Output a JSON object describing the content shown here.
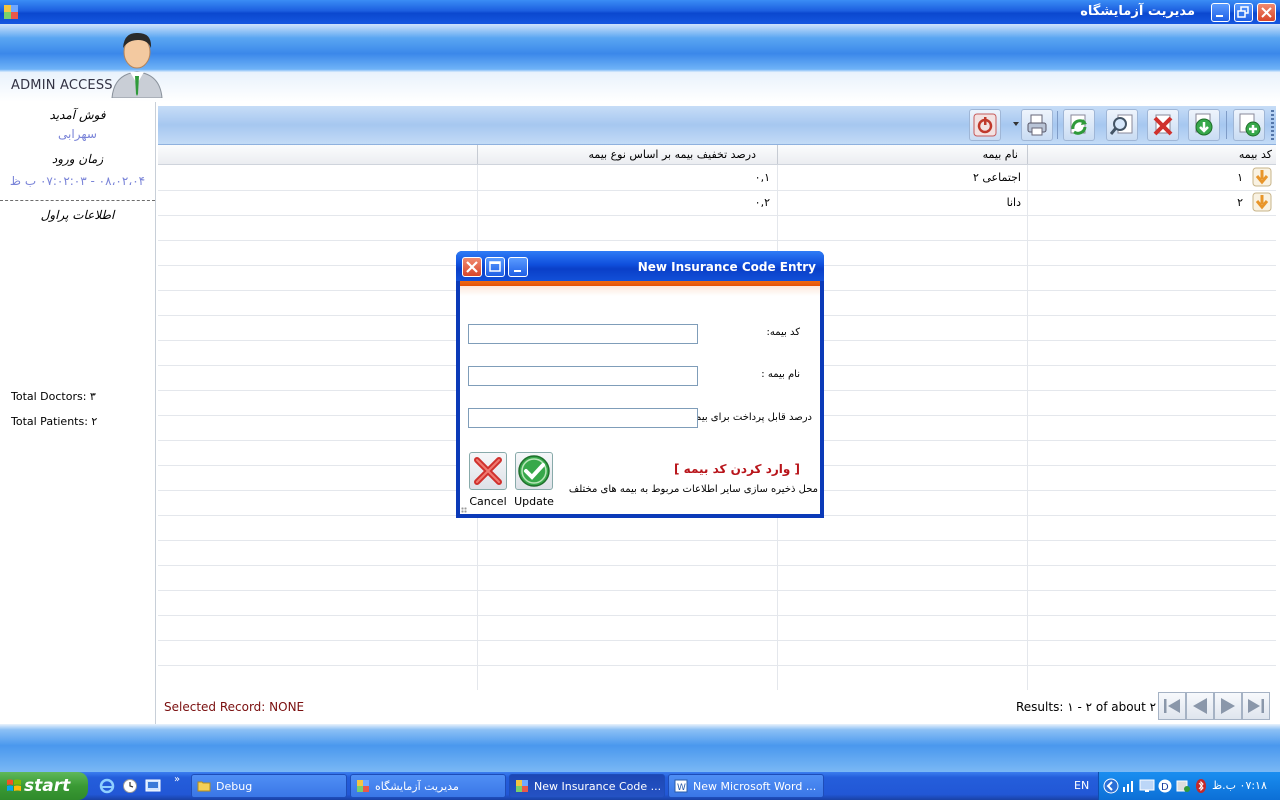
{
  "window": {
    "title": "مدیریت آزمایشگاه"
  },
  "header": {
    "admin_label": "ADMIN ACCESS"
  },
  "sidebar": {
    "user_label": "فوش آمدید",
    "user_name": "سهرابی",
    "login_label": "زمان ورود",
    "login_time": "۰۸،۰۲،۰۴ - ۰۷:۰۲:۰۳ ب ظ",
    "info_label": "اطلاعات پراول",
    "total_doctors": "Total Doctors: ۳",
    "total_patients": "Total Patients: ۲"
  },
  "toolbar": {
    "buttons": [
      "power-icon",
      "print-icon",
      "refresh-icon",
      "search-icon",
      "delete-icon",
      "download-icon",
      "add-icon"
    ]
  },
  "grid": {
    "columns": [
      "کد بیمه",
      "نام بیمه",
      "درصد تخفیف بیمه بر اساس نوع بیمه",
      ""
    ],
    "rows": [
      {
        "code": "۱",
        "name": "اجتماعی ۲",
        "percent": "۰,۱"
      },
      {
        "code": "۲",
        "name": "دانا",
        "percent": "۰,۲"
      }
    ]
  },
  "status": {
    "selected": "Selected Record: NONE",
    "results": "Results: ۱ - ۲ of about ۲"
  },
  "dialog": {
    "title": "New Insurance Code Entry",
    "code_label": "کد بیمه:",
    "name_label": "نام بیمه :",
    "percent_label": "درصد قابل پرداخت برای بیمه",
    "code_value": "",
    "name_value": "",
    "percent_value": "",
    "heading": "[ وارد کردن کد بیمه ]",
    "note": "محل ذخیره سازی سایر اطلاعات مربوط به بیمه های مختلف",
    "cancel_label": "Cancel",
    "update_label": "Update"
  },
  "taskbar": {
    "start_label": "start",
    "tasks": [
      {
        "label": "Debug",
        "active": false
      },
      {
        "label": "مدیریت آزمایشگاه",
        "active": false
      },
      {
        "label": "New Insurance Code ...",
        "active": true
      },
      {
        "label": "New Microsoft Word ...",
        "active": false
      }
    ],
    "lang": "EN",
    "clock": "۰۷:۱۸ ب.ظ"
  },
  "colors": {
    "accent": "#0b48cf",
    "dialog_stripe": "#f06a10",
    "error_red": "#b8141a"
  }
}
